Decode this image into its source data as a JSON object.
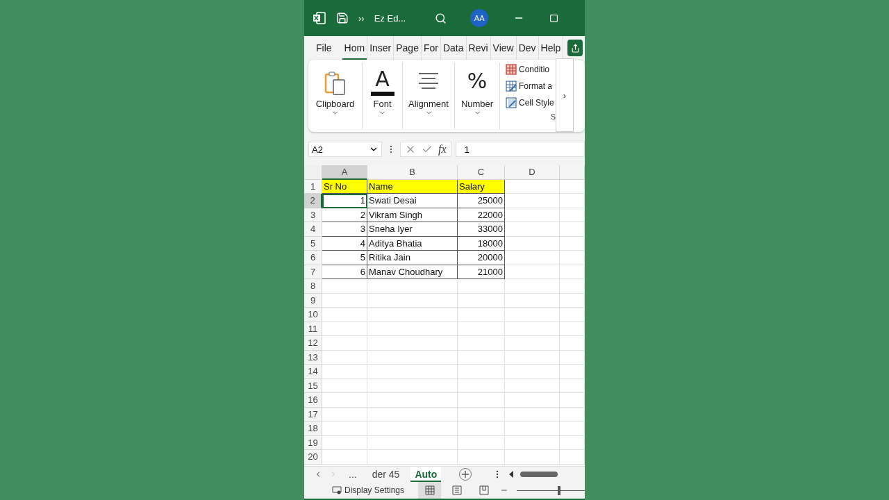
{
  "title_bar": {
    "overflow": "››",
    "title": "Ez Ed...",
    "avatar": "AA"
  },
  "menu_tabs": [
    {
      "label": "File",
      "selected": false
    },
    {
      "label": "Hom",
      "selected": true
    },
    {
      "label": "Inser",
      "selected": false
    },
    {
      "label": "Page",
      "selected": false
    },
    {
      "label": "For",
      "selected": false
    },
    {
      "label": "Data",
      "selected": false
    },
    {
      "label": "Revi",
      "selected": false
    },
    {
      "label": "View",
      "selected": false
    },
    {
      "label": "Dev",
      "selected": false
    },
    {
      "label": "Help",
      "selected": false
    }
  ],
  "ribbon": {
    "groups": [
      {
        "kind": "clipboard",
        "label": "Clipboard"
      },
      {
        "kind": "font",
        "label": "Font",
        "glyph": "A"
      },
      {
        "kind": "alignment",
        "label": "Alignment"
      },
      {
        "kind": "number",
        "label": "Number",
        "glyph": "%"
      }
    ],
    "styles": [
      {
        "kind": "conditional",
        "label": "Conditio"
      },
      {
        "kind": "table",
        "label": "Format a"
      },
      {
        "kind": "cell",
        "label": "Cell Style"
      }
    ],
    "styles_group_label": "S",
    "scroll": "›"
  },
  "formula_bar": {
    "name_box": "A2",
    "function_label": "fx",
    "value": "1"
  },
  "sheet": {
    "columns": [
      {
        "label": "A",
        "selected": true
      },
      {
        "label": "B",
        "selected": false
      },
      {
        "label": "C",
        "selected": false
      },
      {
        "label": "D",
        "selected": false
      }
    ],
    "rows": [
      {
        "number": "1",
        "selected": false,
        "kind": "header",
        "cells": [
          {
            "text": "Sr No",
            "kind": "text",
            "selected": false
          },
          {
            "text": "Name",
            "kind": "text",
            "selected": false
          },
          {
            "text": "Salary",
            "kind": "text",
            "selected": false
          }
        ]
      },
      {
        "number": "2",
        "selected": true,
        "kind": "data",
        "cells": [
          {
            "text": "1",
            "kind": "number",
            "selected": true
          },
          {
            "text": "Swati Desai",
            "kind": "text",
            "selected": false
          },
          {
            "text": "25000",
            "kind": "number",
            "selected": false
          }
        ]
      },
      {
        "number": "3",
        "selected": false,
        "kind": "data",
        "cells": [
          {
            "text": "2",
            "kind": "number",
            "selected": false
          },
          {
            "text": "Vikram Singh",
            "kind": "text",
            "selected": false
          },
          {
            "text": "22000",
            "kind": "number",
            "selected": false
          }
        ]
      },
      {
        "number": "4",
        "selected": false,
        "kind": "data",
        "cells": [
          {
            "text": "3",
            "kind": "number",
            "selected": false
          },
          {
            "text": "Sneha Iyer",
            "kind": "text",
            "selected": false
          },
          {
            "text": "33000",
            "kind": "number",
            "selected": false
          }
        ]
      },
      {
        "number": "5",
        "selected": false,
        "kind": "data",
        "cells": [
          {
            "text": "4",
            "kind": "number",
            "selected": false
          },
          {
            "text": "Aditya Bhatia",
            "kind": "text",
            "selected": false
          },
          {
            "text": "18000",
            "kind": "number",
            "selected": false
          }
        ]
      },
      {
        "number": "6",
        "selected": false,
        "kind": "data",
        "cells": [
          {
            "text": "5",
            "kind": "number",
            "selected": false
          },
          {
            "text": "Ritika Jain",
            "kind": "text",
            "selected": false
          },
          {
            "text": "20000",
            "kind": "number",
            "selected": false
          }
        ]
      },
      {
        "number": "7",
        "selected": false,
        "kind": "data",
        "cells": [
          {
            "text": "6",
            "kind": "number",
            "selected": false
          },
          {
            "text": "Manav Choudhary",
            "kind": "text",
            "selected": false
          },
          {
            "text": "21000",
            "kind": "number",
            "selected": false
          }
        ]
      },
      {
        "number": "8",
        "selected": false,
        "kind": "empty"
      },
      {
        "number": "9",
        "selected": false,
        "kind": "empty"
      },
      {
        "number": "10",
        "selected": false,
        "kind": "empty"
      },
      {
        "number": "11",
        "selected": false,
        "kind": "empty"
      },
      {
        "number": "12",
        "selected": false,
        "kind": "empty"
      },
      {
        "number": "13",
        "selected": false,
        "kind": "empty"
      },
      {
        "number": "14",
        "selected": false,
        "kind": "empty"
      },
      {
        "number": "15",
        "selected": false,
        "kind": "empty"
      },
      {
        "number": "16",
        "selected": false,
        "kind": "empty"
      },
      {
        "number": "17",
        "selected": false,
        "kind": "empty"
      },
      {
        "number": "18",
        "selected": false,
        "kind": "empty"
      },
      {
        "number": "19",
        "selected": false,
        "kind": "empty"
      },
      {
        "number": "20",
        "selected": false,
        "kind": "empty"
      }
    ]
  },
  "sheet_tabs": [
    {
      "label": "...",
      "selected": false
    },
    {
      "label": "der 45",
      "selected": false
    },
    {
      "label": "Auto",
      "selected": true
    }
  ],
  "status_bar": {
    "display_settings": "Display Settings",
    "views": [
      {
        "kind": "normal",
        "selected": true
      },
      {
        "kind": "page_layout",
        "selected": false
      },
      {
        "kind": "page_break",
        "selected": false
      }
    ],
    "zoom": {
      "level": 0.6
    }
  }
}
